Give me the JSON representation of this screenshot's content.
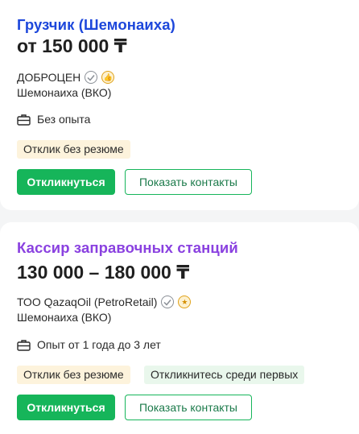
{
  "vacancies": [
    {
      "title": "Грузчик (Шемонаиха)",
      "salary": "от 150 000 ₸",
      "company": "ДОБРОЦЕН",
      "city": "Шемонаиха (ВКО)",
      "experience": "Без опыта",
      "tags": [
        "Отклик без резюме"
      ],
      "respond_label": "Откликнуться",
      "contacts_label": "Показать контакты",
      "title_color": "#1d47db",
      "award_icon": "thumbs-up-icon"
    },
    {
      "title": "Кассир заправочных станций",
      "salary": "130 000 – 180 000 ₸",
      "company": "ТОО QazaqOil (PetroRetail)",
      "city": "Шемонаиха (ВКО)",
      "experience": "Опыт от 1 года до 3 лет",
      "tags": [
        "Отклик без резюме",
        "Откликнитесь среди первых"
      ],
      "respond_label": "Откликнуться",
      "contacts_label": "Показать контакты",
      "title_color": "#8a41e0",
      "award_icon": "star-icon"
    }
  ],
  "colors": {
    "primary_button": "#16b55a",
    "tag_yellow": "#fdf3dc",
    "tag_green": "#e9f7ec"
  }
}
